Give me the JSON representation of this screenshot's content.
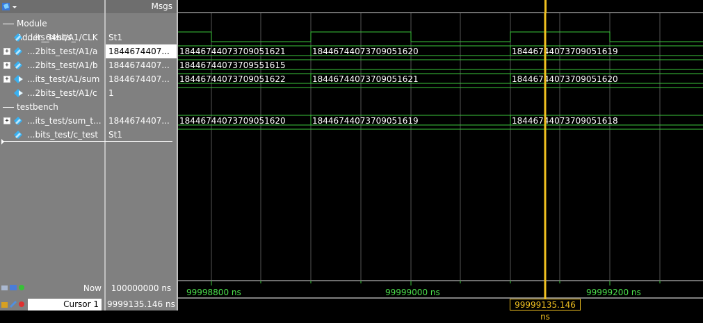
{
  "header": {
    "msgs_label": "Msgs"
  },
  "groups": [
    {
      "label": "Module Adder_64bits_"
    },
    {
      "label": "testbench"
    }
  ],
  "signals": [
    {
      "name": "...its_test/A1/CLK",
      "value": "St1",
      "expandable": false
    },
    {
      "name": "...2bits_test/A1/a",
      "value": "1844674407...",
      "expandable": true,
      "selected": true
    },
    {
      "name": "...2bits_test/A1/b",
      "value": "1844674407...",
      "expandable": true
    },
    {
      "name": "...its_test/A1/sum",
      "value": "1844674407...",
      "expandable": true
    },
    {
      "name": "...2bits_test/A1/c",
      "value": "1",
      "expandable": false
    },
    {
      "name": "...its_test/sum_t...",
      "value": "1844674407...",
      "expandable": true
    },
    {
      "name": "...bits_test/c_test",
      "value": "St1",
      "expandable": false
    }
  ],
  "waves": {
    "a": [
      "18446744073709051621",
      "18446744073709051620",
      "18446744073709051619"
    ],
    "b": [
      "18446744073709551615"
    ],
    "sum": [
      "18446744073709051622",
      "18446744073709051621",
      "18446744073709051620"
    ],
    "sum_test": [
      "18446744073709051620",
      "18446744073709051619",
      "18446744073709051618"
    ]
  },
  "timeline": {
    "now_label": "Now",
    "now_value": "100000000 ns",
    "cursor_label": "Cursor 1",
    "cursor_value": "9999135.146 ns",
    "cursor_box": "99999135.146 ns",
    "ticks": [
      "99998800 ns",
      "99999000 ns",
      "99999200 ns"
    ]
  },
  "colors": {
    "wave": "#3cc83c",
    "cursor": "#f0c020",
    "grid": "#555555"
  }
}
